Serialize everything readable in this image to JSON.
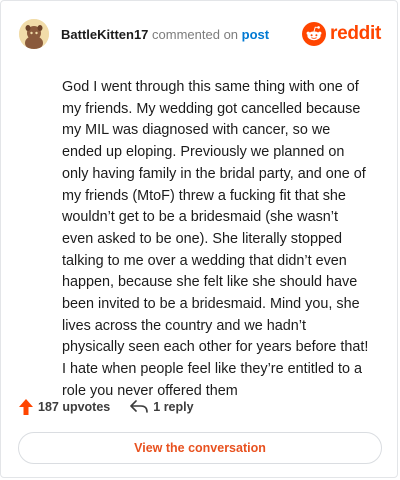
{
  "header": {
    "username": "BattleKitten17",
    "action_text": "commented on",
    "post_link": "post",
    "brand": "reddit"
  },
  "comment": {
    "body": "God I went through this same thing with one of my friends. My wedding got cancelled because my MIL was diagnosed with cancer, so we ended up eloping. Previously we planned on only having family in the bridal party, and one of my friends (MtoF) threw a fucking fit that she wouldn’t get to be a bridesmaid (she wasn’t even asked to be one). She literally stopped talking to me over a wedding that didn’t even happen, because she felt like she should have been invited to be a bridesmaid. Mind you, she lives across the country and we hadn’t physically seen each other for years before that! I hate when people feel like they’re entitled to a role you never offered them"
  },
  "actions": {
    "upvotes": "187 upvotes",
    "replies": "1 reply"
  },
  "cta": {
    "label": "View the conversation"
  },
  "colors": {
    "brand_orange": "#ff4500",
    "link_blue": "#0079d3",
    "cta_text": "#e8511f"
  },
  "icons": {
    "avatar": "snoo-avatar",
    "logo": "reddit-logo-icon",
    "upvote": "upvote-arrow-icon",
    "reply": "reply-arrow-icon"
  }
}
